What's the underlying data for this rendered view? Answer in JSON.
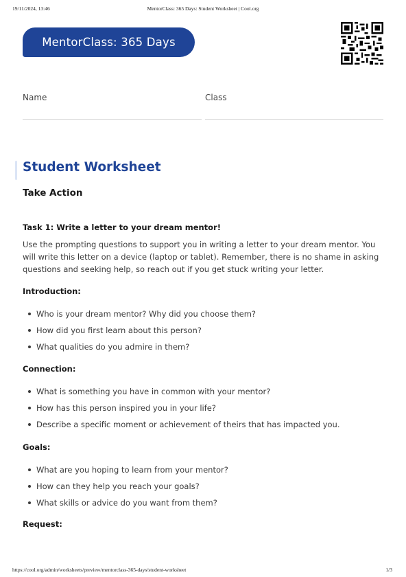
{
  "print_header": {
    "datetime": "19/11/2024, 13:46",
    "doc_title": "MentorClass: 365 Days: Student Worksheet | Cool.org"
  },
  "banner": {
    "text": "MentorClass: 365 Days"
  },
  "fields": {
    "name_label": "Name",
    "class_label": "Class"
  },
  "worksheet": {
    "title": "Student Worksheet",
    "subtitle": "Take Action",
    "task": {
      "title": "Task 1: Write a letter to your dream mentor!",
      "description": "Use the prompting questions to support you in writing a letter to your dream mentor. You will write this letter on a device (laptop or tablet). Remember, there is no shame in asking questions and seeking help, so reach out if you get stuck writing your letter."
    },
    "sections": [
      {
        "heading": "Introduction:",
        "items": [
          "Who is your dream mentor? Why did you choose them?",
          "How did you first learn about this person?",
          "What qualities do you admire in them?"
        ]
      },
      {
        "heading": "Connection:",
        "items": [
          "What is something you have in common with your mentor?",
          "How has this person inspired you in your life?",
          "Describe a specific moment or achievement of theirs that has impacted you."
        ]
      },
      {
        "heading": "Goals:",
        "items": [
          "What are you hoping to learn from your mentor?",
          "How can they help you reach your goals?",
          "What skills or advice do you want from them?"
        ]
      },
      {
        "heading": "Request:",
        "items": []
      }
    ]
  },
  "print_footer": {
    "url": "https://cool.org/admin/worksheets/preview/mentorclass-365-days/student-worksheet",
    "page": "1/3"
  },
  "colors": {
    "brand": "#1f4497",
    "text": "#3a3a3a"
  },
  "icons": {
    "qr": "qr-code-icon"
  }
}
